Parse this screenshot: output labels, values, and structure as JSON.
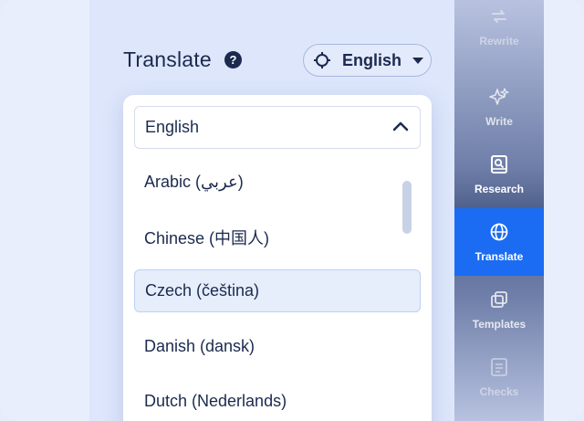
{
  "header": {
    "title": "Translate",
    "help_icon": "question-circle-icon",
    "language_pill": {
      "icon": "crosshair-icon",
      "label": "English"
    }
  },
  "dropdown": {
    "selected_value": "English",
    "options": [
      {
        "label": "Arabic (عربي)",
        "selected": false
      },
      {
        "label": "Chinese (中国人)",
        "selected": false
      },
      {
        "label": "Czech (čeština)",
        "selected": true
      },
      {
        "label": "Danish (dansk)",
        "selected": false
      },
      {
        "label": "Dutch (Nederlands)",
        "selected": false
      }
    ]
  },
  "sidebar": {
    "items": [
      {
        "label": "Rewrite",
        "icon": "arrows-cycle-icon",
        "active": false
      },
      {
        "label": "Write",
        "icon": "sparkle-icon",
        "active": false
      },
      {
        "label": "Research",
        "icon": "book-search-icon",
        "active": false
      },
      {
        "label": "Translate",
        "icon": "globe-icon",
        "active": true
      },
      {
        "label": "Templates",
        "icon": "layers-icon",
        "active": false
      },
      {
        "label": "Checks",
        "icon": "checklist-icon",
        "active": false
      }
    ]
  },
  "colors": {
    "accent": "#1b6cf2",
    "text_dark": "#1b2a4e",
    "selected_bg": "#e6eefc"
  }
}
